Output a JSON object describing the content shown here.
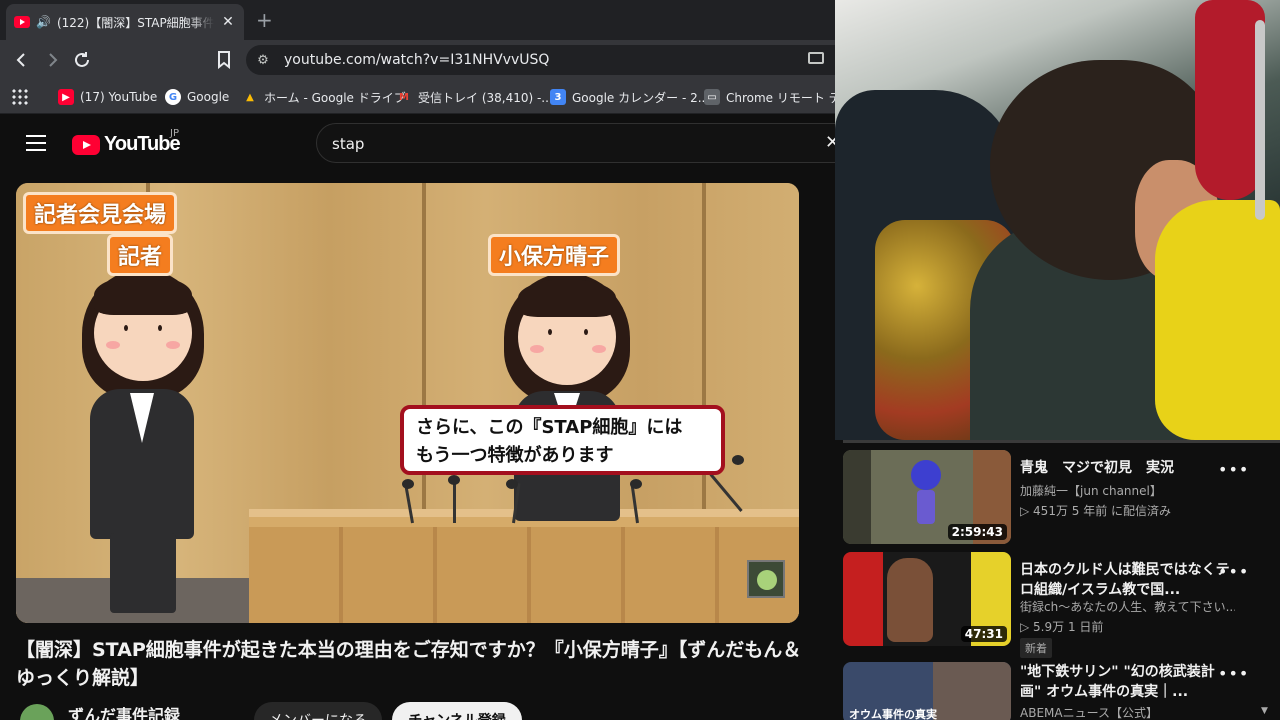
{
  "tab": {
    "title": "(122)【闇深】STAP細胞事件が起",
    "close": "✕",
    "new_tab": "+"
  },
  "toolbar": {
    "url": "youtube.com/watch?v=I31NHVvvUSQ"
  },
  "bookmarks": [
    {
      "label": "(17) YouTube",
      "icon_color": "#ff0033"
    },
    {
      "label": "Google",
      "icon_color": "#4285f4"
    },
    {
      "label": "ホーム - Google ドライブ",
      "icon_color": "#1fa463"
    },
    {
      "label": "受信トレイ (38,410) -...",
      "icon_color": "#ea4335"
    },
    {
      "label": "Google カレンダー - 2...",
      "icon_color": "#4285f4"
    },
    {
      "label": "Chrome リモート デス...",
      "icon_color": "#c4c7c5"
    }
  ],
  "youtube": {
    "logo_text": "YouTube",
    "region": "JP",
    "search_query": "stap",
    "clear_search": "✕"
  },
  "video": {
    "labels": {
      "venue": "記者会見会場",
      "reporter": "記者",
      "speaker": "小保方晴子"
    },
    "subtitle_lines": [
      "さらに、この『STAP細胞』には",
      "もう一つ特徴があります"
    ],
    "title": "【闇深】STAP細胞事件が起きた本当の理由をご存知ですか？『小保方晴子』【ずんだもん＆ゆっくり解説】",
    "channel_name": "ずんだ事件記録",
    "member_button": "メンバーになる",
    "subscribe_button": "チャンネル登録"
  },
  "recommendations": [
    {
      "title": "青鬼　マジで初見　実況",
      "channel": "加藤純一【jun channel】",
      "meta": "▷ 451万  5 年前 に配信済み",
      "duration": "2:59:43",
      "badge": ""
    },
    {
      "title": "日本のクルド人は難民ではなくテロ組織/イスラム教で国...",
      "channel": "街録ch〜あなたの人生、教えて下さい...",
      "meta": "▷ 5.9万  1 日前",
      "duration": "47:31",
      "badge": "新着"
    },
    {
      "title": "\"地下鉄サリン\" \"幻の核武装計画\" オウム事件の真実｜...",
      "channel": "ABEMAニュース【公式】",
      "meta": "",
      "duration": "",
      "badge": "",
      "thumb_caption": "オウム事件の真実"
    }
  ],
  "colors": {
    "youtube_red": "#ff0033",
    "label_orange": "#f47d1f",
    "subtitle_border": "#a30f1e"
  }
}
